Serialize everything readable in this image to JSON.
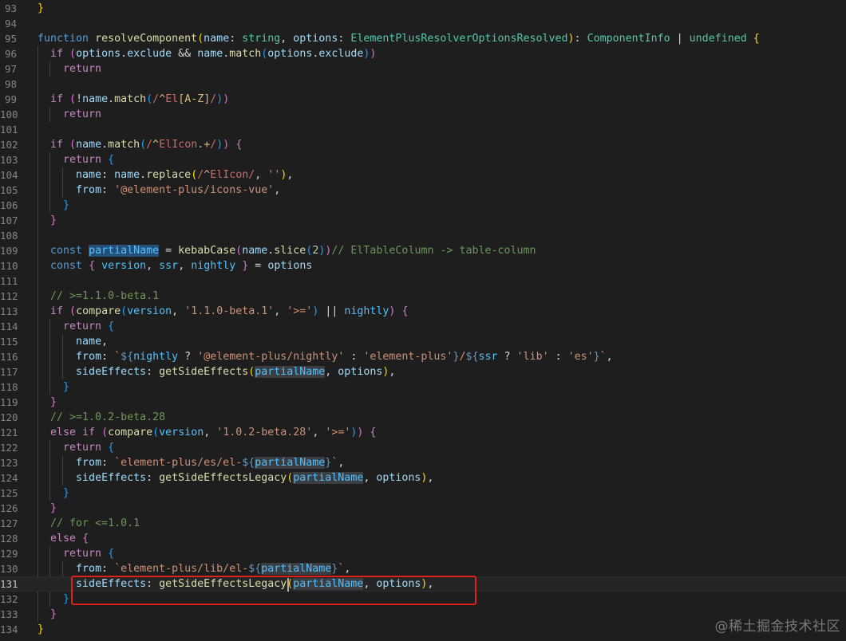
{
  "editor": {
    "current_line": 131,
    "lines": [
      {
        "n": "93",
        "t": [
          [
            "}",
            "b1"
          ]
        ]
      },
      {
        "n": "94",
        "t": []
      },
      {
        "n": "95",
        "t": [
          [
            "function",
            "kw"
          ],
          [
            " ",
            "pl"
          ],
          [
            "resolveComponent",
            "fn"
          ],
          [
            "(",
            "b1"
          ],
          [
            "name",
            "var"
          ],
          [
            ": ",
            "pl"
          ],
          [
            "string",
            "ty"
          ],
          [
            ", ",
            "pl"
          ],
          [
            "options",
            "var"
          ],
          [
            ": ",
            "pl"
          ],
          [
            "ElementPlusResolverOptionsResolved",
            "ty"
          ],
          [
            ")",
            "b1"
          ],
          [
            ": ",
            "pl"
          ],
          [
            "ComponentInfo",
            "ty"
          ],
          [
            " | ",
            "pl"
          ],
          [
            "undefined",
            "ty"
          ],
          [
            " ",
            "pl"
          ],
          [
            "{",
            "b1"
          ]
        ]
      },
      {
        "n": "96",
        "t": [
          [
            "  ",
            "pl"
          ],
          [
            "if",
            "kwc"
          ],
          [
            " ",
            "pl"
          ],
          [
            "(",
            "b2"
          ],
          [
            "options",
            "var"
          ],
          [
            ".",
            "pl"
          ],
          [
            "exclude",
            "var"
          ],
          [
            " && ",
            "pl"
          ],
          [
            "name",
            "var"
          ],
          [
            ".",
            "pl"
          ],
          [
            "match",
            "fn"
          ],
          [
            "(",
            "b3"
          ],
          [
            "options",
            "var"
          ],
          [
            ".",
            "pl"
          ],
          [
            "exclude",
            "var"
          ],
          [
            ")",
            "b3"
          ],
          [
            ")",
            "b2"
          ]
        ]
      },
      {
        "n": "97",
        "t": [
          [
            "    ",
            "pl"
          ],
          [
            "return",
            "kwc"
          ]
        ]
      },
      {
        "n": "98",
        "t": []
      },
      {
        "n": "99",
        "t": [
          [
            "  ",
            "pl"
          ],
          [
            "if",
            "kwc"
          ],
          [
            " ",
            "pl"
          ],
          [
            "(",
            "b2"
          ],
          [
            "!",
            "pl"
          ],
          [
            "name",
            "var"
          ],
          [
            ".",
            "pl"
          ],
          [
            "match",
            "fn"
          ],
          [
            "(",
            "b3"
          ],
          [
            "/",
            "rx"
          ],
          [
            "^",
            "rxc"
          ],
          [
            "El",
            "rx"
          ],
          [
            "[A-Z]",
            "rxc"
          ],
          [
            "/",
            "rx"
          ],
          [
            ")",
            "b3"
          ],
          [
            ")",
            "b2"
          ]
        ]
      },
      {
        "n": "100",
        "t": [
          [
            "    ",
            "pl"
          ],
          [
            "return",
            "kwc"
          ]
        ]
      },
      {
        "n": "101",
        "t": []
      },
      {
        "n": "102",
        "t": [
          [
            "  ",
            "pl"
          ],
          [
            "if",
            "kwc"
          ],
          [
            " ",
            "pl"
          ],
          [
            "(",
            "b2"
          ],
          [
            "name",
            "var"
          ],
          [
            ".",
            "pl"
          ],
          [
            "match",
            "fn"
          ],
          [
            "(",
            "b3"
          ],
          [
            "/",
            "rx"
          ],
          [
            "^",
            "rxc"
          ],
          [
            "ElIcon",
            "rx"
          ],
          [
            ".+",
            "rxc"
          ],
          [
            "/",
            "rx"
          ],
          [
            ")",
            "b3"
          ],
          [
            ")",
            "b2"
          ],
          [
            " ",
            "pl"
          ],
          [
            "{",
            "b2"
          ]
        ]
      },
      {
        "n": "103",
        "t": [
          [
            "    ",
            "pl"
          ],
          [
            "return",
            "kwc"
          ],
          [
            " ",
            "pl"
          ],
          [
            "{",
            "b3"
          ]
        ]
      },
      {
        "n": "104",
        "t": [
          [
            "      ",
            "pl"
          ],
          [
            "name",
            "var"
          ],
          [
            ": ",
            "pl"
          ],
          [
            "name",
            "var"
          ],
          [
            ".",
            "pl"
          ],
          [
            "replace",
            "fn"
          ],
          [
            "(",
            "b1"
          ],
          [
            "/",
            "rx"
          ],
          [
            "^",
            "rxc"
          ],
          [
            "ElIcon",
            "rx"
          ],
          [
            "/",
            "rx"
          ],
          [
            ", ",
            "pl"
          ],
          [
            "''",
            "str"
          ],
          [
            ")",
            "b1"
          ],
          [
            ",",
            "pl"
          ]
        ]
      },
      {
        "n": "105",
        "t": [
          [
            "      ",
            "pl"
          ],
          [
            "from",
            "var"
          ],
          [
            ": ",
            "pl"
          ],
          [
            "'@element-plus/icons-vue'",
            "str"
          ],
          [
            ",",
            "pl"
          ]
        ]
      },
      {
        "n": "106",
        "t": [
          [
            "    ",
            "pl"
          ],
          [
            "}",
            "b3"
          ]
        ]
      },
      {
        "n": "107",
        "t": [
          [
            "  ",
            "pl"
          ],
          [
            "}",
            "b2"
          ]
        ]
      },
      {
        "n": "108",
        "t": []
      },
      {
        "n": "109",
        "t": [
          [
            "  ",
            "pl"
          ],
          [
            "const",
            "kw"
          ],
          [
            " ",
            "pl"
          ],
          [
            "partialName",
            "cvar sel"
          ],
          [
            " = ",
            "pl"
          ],
          [
            "kebabCase",
            "fn"
          ],
          [
            "(",
            "b2"
          ],
          [
            "name",
            "var"
          ],
          [
            ".",
            "pl"
          ],
          [
            "slice",
            "fn"
          ],
          [
            "(",
            "b3"
          ],
          [
            "2",
            "num"
          ],
          [
            ")",
            "b3"
          ],
          [
            ")",
            "b2"
          ],
          [
            "// ElTableColumn -> table-column",
            "com"
          ]
        ]
      },
      {
        "n": "110",
        "t": [
          [
            "  ",
            "pl"
          ],
          [
            "const",
            "kw"
          ],
          [
            " ",
            "pl"
          ],
          [
            "{",
            "b2"
          ],
          [
            " ",
            "pl"
          ],
          [
            "version",
            "cvar"
          ],
          [
            ", ",
            "pl"
          ],
          [
            "ssr",
            "cvar"
          ],
          [
            ", ",
            "pl"
          ],
          [
            "nightly",
            "cvar"
          ],
          [
            " ",
            "pl"
          ],
          [
            "}",
            "b2"
          ],
          [
            " = ",
            "pl"
          ],
          [
            "options",
            "var"
          ]
        ]
      },
      {
        "n": "111",
        "t": []
      },
      {
        "n": "112",
        "t": [
          [
            "  ",
            "pl"
          ],
          [
            "// >=1.1.0-beta.1",
            "com"
          ]
        ]
      },
      {
        "n": "113",
        "t": [
          [
            "  ",
            "pl"
          ],
          [
            "if",
            "kwc"
          ],
          [
            " ",
            "pl"
          ],
          [
            "(",
            "b2"
          ],
          [
            "compare",
            "fn"
          ],
          [
            "(",
            "b3"
          ],
          [
            "version",
            "cvar"
          ],
          [
            ", ",
            "pl"
          ],
          [
            "'1.1.0-beta.1'",
            "str"
          ],
          [
            ", ",
            "pl"
          ],
          [
            "'>='",
            "str"
          ],
          [
            ")",
            "b3"
          ],
          [
            " || ",
            "pl"
          ],
          [
            "nightly",
            "cvar"
          ],
          [
            ")",
            "b2"
          ],
          [
            " ",
            "pl"
          ],
          [
            "{",
            "b2"
          ]
        ]
      },
      {
        "n": "114",
        "t": [
          [
            "    ",
            "pl"
          ],
          [
            "return",
            "kwc"
          ],
          [
            " ",
            "pl"
          ],
          [
            "{",
            "b3"
          ]
        ]
      },
      {
        "n": "115",
        "t": [
          [
            "      ",
            "pl"
          ],
          [
            "name",
            "var"
          ],
          [
            ",",
            "pl"
          ]
        ]
      },
      {
        "n": "116",
        "t": [
          [
            "      ",
            "pl"
          ],
          [
            "from",
            "var"
          ],
          [
            ": ",
            "pl"
          ],
          [
            "`",
            "str"
          ],
          [
            "${",
            "kw"
          ],
          [
            "nightly",
            "cvar"
          ],
          [
            " ? ",
            "pl"
          ],
          [
            "'@element-plus/nightly'",
            "str"
          ],
          [
            " : ",
            "pl"
          ],
          [
            "'element-plus'",
            "str"
          ],
          [
            "}",
            "kw"
          ],
          [
            "/",
            "str"
          ],
          [
            "${",
            "kw"
          ],
          [
            "ssr",
            "cvar"
          ],
          [
            " ? ",
            "pl"
          ],
          [
            "'lib'",
            "str"
          ],
          [
            " : ",
            "pl"
          ],
          [
            "'es'",
            "str"
          ],
          [
            "}",
            "kw"
          ],
          [
            "`",
            "str"
          ],
          [
            ",",
            "pl"
          ]
        ]
      },
      {
        "n": "117",
        "t": [
          [
            "      ",
            "pl"
          ],
          [
            "sideEffects",
            "var"
          ],
          [
            ": ",
            "pl"
          ],
          [
            "getSideEffects",
            "fn"
          ],
          [
            "(",
            "b1"
          ],
          [
            "partialName",
            "cvar occ"
          ],
          [
            ", ",
            "pl"
          ],
          [
            "options",
            "var"
          ],
          [
            ")",
            "b1"
          ],
          [
            ",",
            "pl"
          ]
        ]
      },
      {
        "n": "118",
        "t": [
          [
            "    ",
            "pl"
          ],
          [
            "}",
            "b3"
          ]
        ]
      },
      {
        "n": "119",
        "t": [
          [
            "  ",
            "pl"
          ],
          [
            "}",
            "b2"
          ]
        ]
      },
      {
        "n": "120",
        "t": [
          [
            "  ",
            "pl"
          ],
          [
            "// >=1.0.2-beta.28",
            "com"
          ]
        ]
      },
      {
        "n": "121",
        "t": [
          [
            "  ",
            "pl"
          ],
          [
            "else",
            "kwc"
          ],
          [
            " ",
            "pl"
          ],
          [
            "if",
            "kwc"
          ],
          [
            " ",
            "pl"
          ],
          [
            "(",
            "b2"
          ],
          [
            "compare",
            "fn"
          ],
          [
            "(",
            "b3"
          ],
          [
            "version",
            "cvar"
          ],
          [
            ", ",
            "pl"
          ],
          [
            "'1.0.2-beta.28'",
            "str"
          ],
          [
            ", ",
            "pl"
          ],
          [
            "'>='",
            "str"
          ],
          [
            ")",
            "b3"
          ],
          [
            ")",
            "b2"
          ],
          [
            " ",
            "pl"
          ],
          [
            "{",
            "b2"
          ]
        ]
      },
      {
        "n": "122",
        "t": [
          [
            "    ",
            "pl"
          ],
          [
            "return",
            "kwc"
          ],
          [
            " ",
            "pl"
          ],
          [
            "{",
            "b3"
          ]
        ]
      },
      {
        "n": "123",
        "t": [
          [
            "      ",
            "pl"
          ],
          [
            "from",
            "var"
          ],
          [
            ": ",
            "pl"
          ],
          [
            "`element-plus/es/el-",
            "str"
          ],
          [
            "${",
            "kw"
          ],
          [
            "partialName",
            "cvar occ"
          ],
          [
            "}",
            "kw"
          ],
          [
            "`",
            "str"
          ],
          [
            ",",
            "pl"
          ]
        ]
      },
      {
        "n": "124",
        "t": [
          [
            "      ",
            "pl"
          ],
          [
            "sideEffects",
            "var"
          ],
          [
            ": ",
            "pl"
          ],
          [
            "getSideEffectsLegacy",
            "fn"
          ],
          [
            "(",
            "b1"
          ],
          [
            "partialName",
            "cvar occ"
          ],
          [
            ", ",
            "pl"
          ],
          [
            "options",
            "var"
          ],
          [
            ")",
            "b1"
          ],
          [
            ",",
            "pl"
          ]
        ]
      },
      {
        "n": "125",
        "t": [
          [
            "    ",
            "pl"
          ],
          [
            "}",
            "b3"
          ]
        ]
      },
      {
        "n": "126",
        "t": [
          [
            "  ",
            "pl"
          ],
          [
            "}",
            "b2"
          ]
        ]
      },
      {
        "n": "127",
        "t": [
          [
            "  ",
            "pl"
          ],
          [
            "// for <=1.0.1",
            "com"
          ]
        ]
      },
      {
        "n": "128",
        "t": [
          [
            "  ",
            "pl"
          ],
          [
            "else",
            "kwc"
          ],
          [
            " ",
            "pl"
          ],
          [
            "{",
            "b2"
          ]
        ]
      },
      {
        "n": "129",
        "t": [
          [
            "    ",
            "pl"
          ],
          [
            "return",
            "kwc"
          ],
          [
            " ",
            "pl"
          ],
          [
            "{",
            "b3"
          ]
        ]
      },
      {
        "n": "130",
        "t": [
          [
            "      ",
            "pl"
          ],
          [
            "from",
            "var"
          ],
          [
            ": ",
            "pl"
          ],
          [
            "`element-plus/lib/el-",
            "str"
          ],
          [
            "${",
            "kw"
          ],
          [
            "partialName",
            "cvar occ"
          ],
          [
            "}",
            "kw"
          ],
          [
            "`",
            "str"
          ],
          [
            ",",
            "pl"
          ]
        ]
      },
      {
        "n": "131",
        "t": [
          [
            "      ",
            "pl"
          ],
          [
            "sideEffects",
            "var"
          ],
          [
            ": ",
            "pl"
          ],
          [
            "getSideEffectsLegacy",
            "fn"
          ],
          [
            "(",
            "b1"
          ],
          [
            "partialName",
            "cvar occ"
          ],
          [
            ", ",
            "pl"
          ],
          [
            "options",
            "var"
          ],
          [
            ")",
            "b1"
          ],
          [
            ",",
            "pl"
          ]
        ]
      },
      {
        "n": "132",
        "t": [
          [
            "    ",
            "pl"
          ],
          [
            "}",
            "b3"
          ]
        ]
      },
      {
        "n": "133",
        "t": [
          [
            "  ",
            "pl"
          ],
          [
            "}",
            "b2"
          ]
        ]
      },
      {
        "n": "134",
        "t": [
          [
            "}",
            "b1"
          ]
        ]
      }
    ]
  },
  "watermark": "@稀土掘金技术社区",
  "colors": {
    "background": "#1e1e1e",
    "keyword": "#569cd6",
    "control": "#c586c0",
    "function": "#dcdcaa",
    "variable": "#9cdcfe",
    "type": "#4ec9b0",
    "string": "#ce9178",
    "comment": "#6a9955",
    "annotation_box": "#e0201a"
  }
}
